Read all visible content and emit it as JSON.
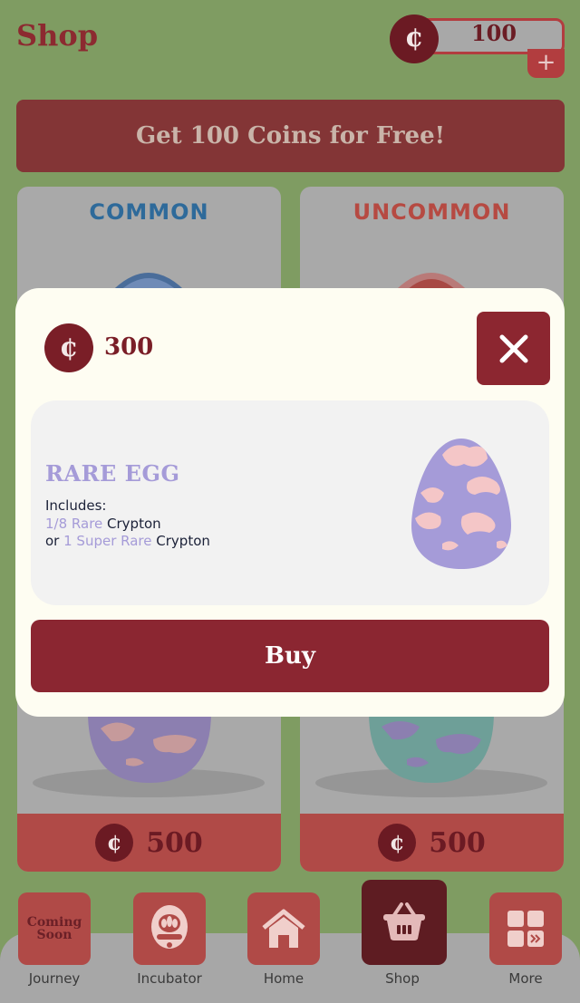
{
  "header": {
    "title": "Shop",
    "coin_symbol": "¢",
    "balance": "100",
    "add_label": "+"
  },
  "banner": {
    "label": "Get 100 Coins for Free!"
  },
  "cards": [
    {
      "label": "COMMON",
      "label_color": "#2e6a9a",
      "price": "500"
    },
    {
      "label": "UNCOMMON",
      "label_color": "#b64a42",
      "price": "500"
    }
  ],
  "modal": {
    "coin_symbol": "¢",
    "price": "300",
    "close_icon": "close-icon",
    "egg_name": "RARE EGG",
    "includes_label": "Includes:",
    "line1": {
      "amount": "1/8 Rare",
      "suffix": " Crypton"
    },
    "line2": {
      "prefix": "or ",
      "amount": "1 Super Rare",
      "suffix": " Crypton"
    },
    "buy_label": "Buy",
    "egg_colors": {
      "shell": "#a59bd8",
      "spots": "#f4c6c7"
    }
  },
  "nav": [
    {
      "label": "Journey",
      "icon": "coming-soon-icon",
      "badge": "Coming Soon"
    },
    {
      "label": "Incubator",
      "icon": "incubator-icon"
    },
    {
      "label": "Home",
      "icon": "home-icon"
    },
    {
      "label": "Shop",
      "icon": "basket-icon",
      "active": true
    },
    {
      "label": "More",
      "icon": "grid-icon"
    }
  ],
  "colors": {
    "background": "#7f9c62",
    "accent": "#8b2631",
    "modal_bg": "#fefdf2"
  }
}
